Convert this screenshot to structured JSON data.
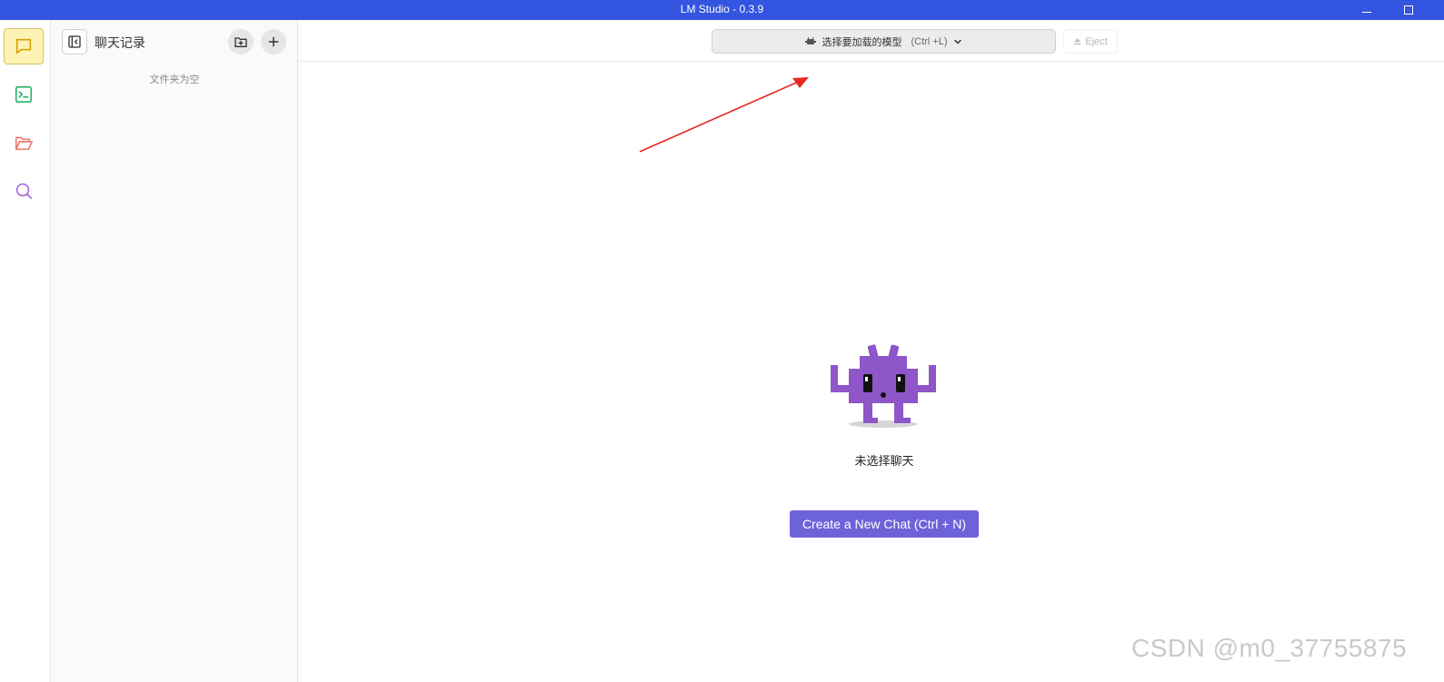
{
  "window": {
    "title": "LM Studio - 0.3.9"
  },
  "rail": {
    "items": [
      {
        "icon": "chat-bubble-icon",
        "color": "#d4a300",
        "active": true
      },
      {
        "icon": "terminal-icon",
        "color": "#2fb36e",
        "active": false
      },
      {
        "icon": "folder-open-icon",
        "color": "#ee7b73",
        "active": false
      },
      {
        "icon": "search-icon",
        "color": "#a76ae0",
        "active": false
      }
    ]
  },
  "sidebar": {
    "title": "聊天记录",
    "empty_text": "文件夹为空"
  },
  "topbar": {
    "model_select_label": "选择要加载的模型",
    "model_select_shortcut": "(Ctrl +L)",
    "eject_label": "Eject"
  },
  "main": {
    "empty_chat_text": "未选择聊天",
    "create_button_label": "Create a New Chat (Ctrl + N)"
  },
  "watermark": "CSDN @m0_37755875",
  "colors": {
    "titlebar": "#3355e0",
    "accent_button": "#6e62d8",
    "mascot": "#8e56c8",
    "annotation_arrow": "#e8271f"
  }
}
